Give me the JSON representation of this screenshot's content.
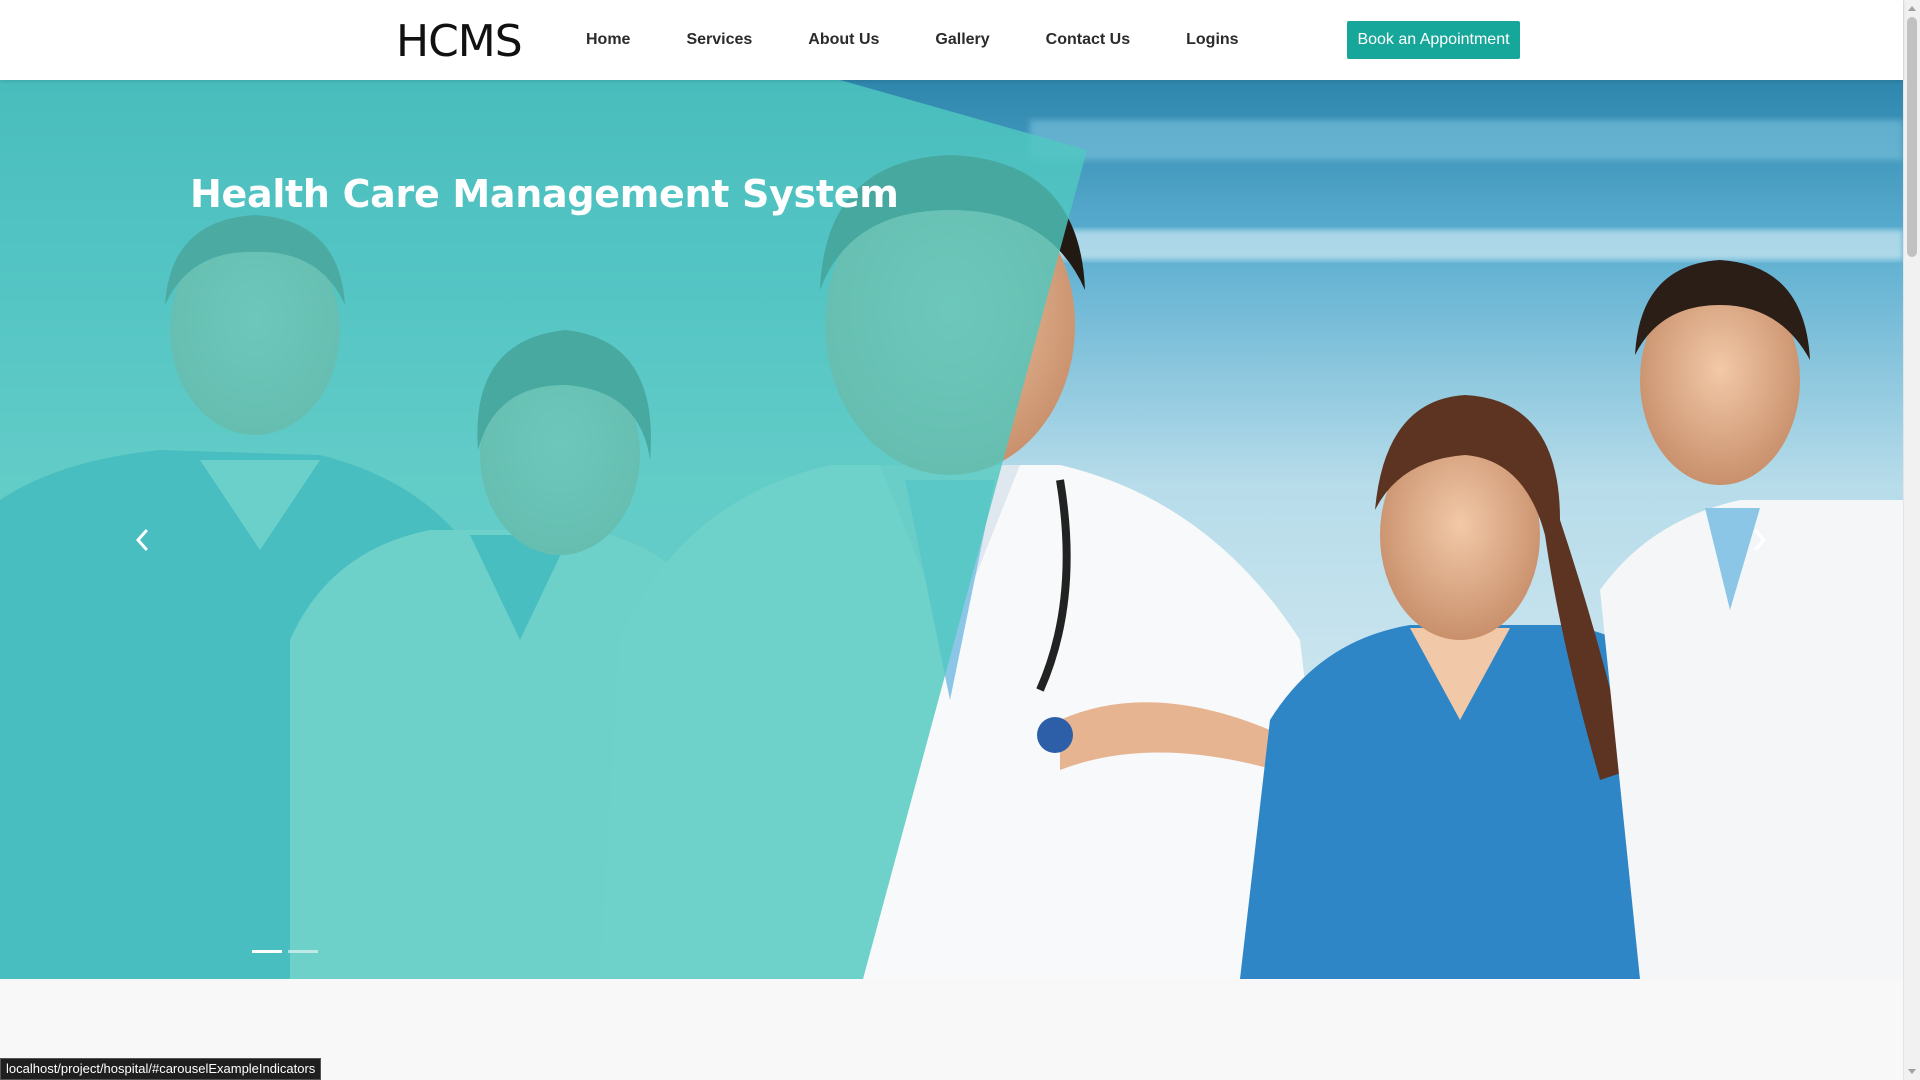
{
  "header": {
    "logo": "HCMS",
    "nav": [
      {
        "label": "Home"
      },
      {
        "label": "Services"
      },
      {
        "label": "About Us"
      },
      {
        "label": "Gallery"
      },
      {
        "label": "Contact Us"
      },
      {
        "label": "Logins"
      }
    ],
    "cta_label": "Book an Appointment"
  },
  "hero": {
    "title": "Health Care Management System",
    "prev_icon": "chevron-left-icon",
    "next_icon": "chevron-right-icon",
    "slide_count": 2,
    "active_slide": 1,
    "overlay_color": "#4fc8c0",
    "image_description_icon": "doctors-photo"
  },
  "status_bar": {
    "url": "localhost/project/hospital/#carouselExampleIndicators"
  },
  "colors": {
    "accent": "#17a79a",
    "header_bg": "#ffffff",
    "overlay": "#4fc8c0"
  }
}
